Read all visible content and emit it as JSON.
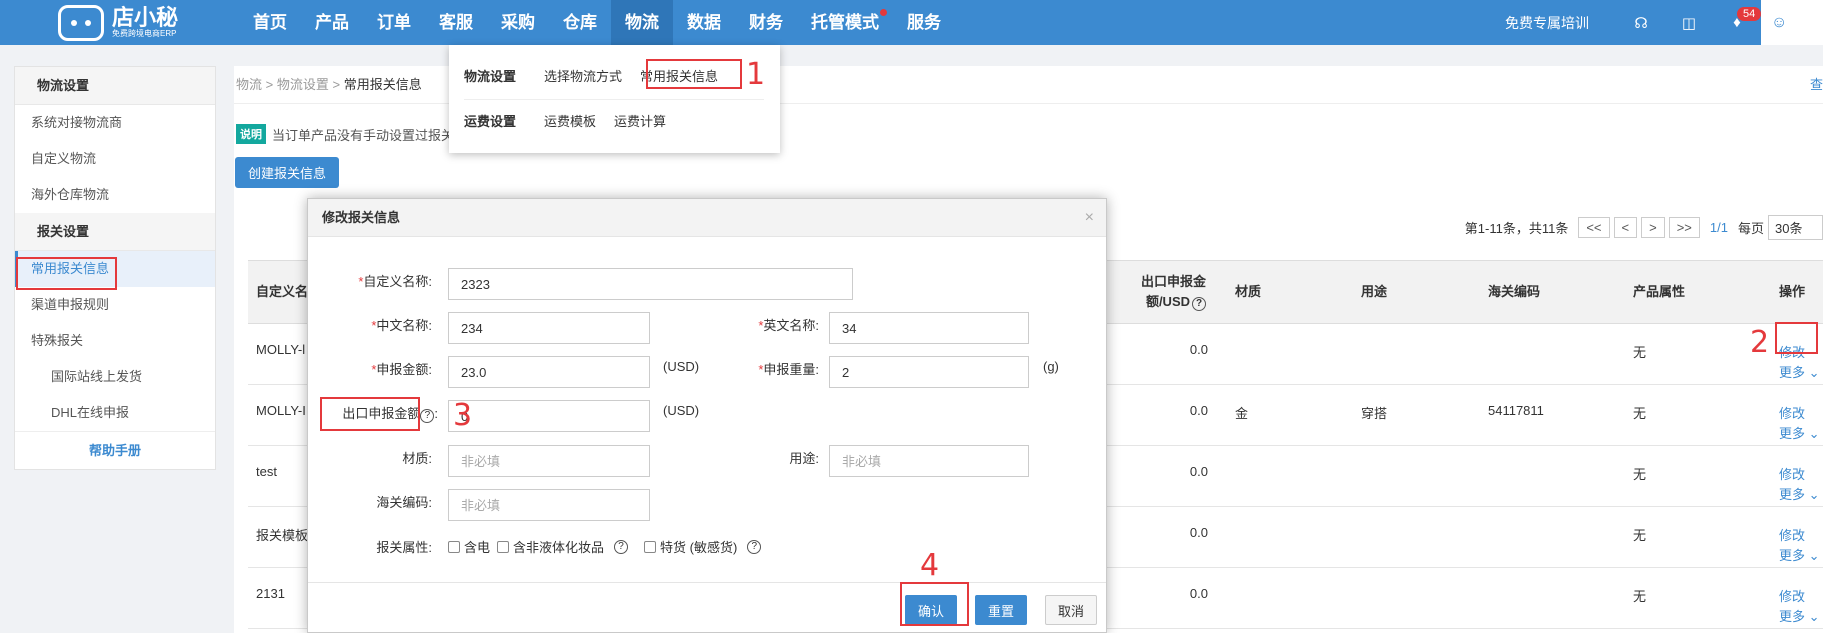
{
  "header": {
    "logo_name": "店小秘",
    "logo_sub": "免费跨境电商ERP",
    "nav": [
      "首页",
      "产品",
      "订单",
      "客服",
      "采购",
      "仓库",
      "物流",
      "数据",
      "财务",
      "托管模式",
      "服务"
    ],
    "training": "免费专属培训",
    "notification_count": "54"
  },
  "dropdown": {
    "logistics_settings": "物流设置",
    "select_method": "选择物流方式",
    "common_customs": "常用报关信息",
    "freight_settings": "运费设置",
    "freight_template": "运费模板",
    "freight_calc": "运费计算"
  },
  "sidebar": {
    "logistics_header": "物流设置",
    "logistics_items": [
      "系统对接物流商",
      "自定义物流",
      "海外仓库物流"
    ],
    "customs_header": "报关设置",
    "customs_items": [
      "常用报关信息",
      "渠道申报规则",
      "特殊报关"
    ],
    "special_items": [
      "国际站线上发货",
      "DHL在线申报"
    ],
    "help": "帮助手册"
  },
  "breadcrumb": {
    "a": "物流",
    "b": "物流设置",
    "c": "常用报关信息",
    "sep": ">",
    "right": "查"
  },
  "note": {
    "tag": "说明",
    "text": "当订单产品没有手动设置过报关"
  },
  "create_button": "创建报关信息",
  "pager": {
    "summary": "第1-11条，共11条",
    "first": "<<",
    "prev": "<",
    "next": ">",
    "last": ">>",
    "page": "1/1",
    "per_page_label": "每页",
    "per_page": "30条"
  },
  "table": {
    "headers": {
      "name": "自定义名",
      "export_amount_1": "出口申报金",
      "export_amount_2": "额/USD",
      "material": "材质",
      "use": "用途",
      "hs_code": "海关编码",
      "attr": "产品属性",
      "ops": "操作"
    },
    "edit": "修改",
    "more": "更多",
    "rows": [
      {
        "name": "MOLLY-l",
        "amount": "0.0",
        "material": "",
        "use": "",
        "hs": "",
        "attr": "无"
      },
      {
        "name": "MOLLY-I",
        "amount": "0.0",
        "material": "金",
        "use": "穿搭",
        "hs": "54117811",
        "attr": "无"
      },
      {
        "name": "test",
        "amount": "0.0",
        "material": "",
        "use": "",
        "hs": "",
        "attr": "无"
      },
      {
        "name": "报关模板",
        "amount": "0.0",
        "material": "",
        "use": "",
        "hs": "",
        "attr": "无"
      },
      {
        "name": "2131",
        "amount": "0.0",
        "material": "",
        "use": "",
        "hs": "",
        "attr": "无"
      }
    ]
  },
  "modal": {
    "title": "修改报关信息",
    "close": "×",
    "custom_name_label": "自定义名称:",
    "custom_name": "2323",
    "cn_name_label": "中文名称:",
    "cn_name": "234",
    "en_name_label": "英文名称:",
    "en_name": "34",
    "declare_amount_label": "申报金额:",
    "declare_amount": "23.0",
    "usd": "(USD)",
    "declare_weight_label": "申报重量:",
    "declare_weight": "2",
    "gram": "(g)",
    "export_amount_label": "出口申报金额",
    "export_amount": "0",
    "material_label": "材质:",
    "material_placeholder": "非必填",
    "use_label": "用途:",
    "use_placeholder": "非必填",
    "hs_label": "海关编码:",
    "hs_placeholder": "非必填",
    "attr_label": "报关属性:",
    "attr_options": [
      "含电",
      "含非液体化妆品",
      "特货 (敏感货)"
    ],
    "confirm": "确认",
    "reset": "重置",
    "cancel": "取消"
  },
  "annotations": [
    "1",
    "2",
    "3",
    "4"
  ]
}
